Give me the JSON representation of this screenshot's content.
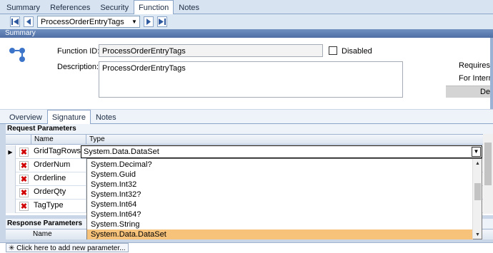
{
  "top_tabs": [
    "Summary",
    "References",
    "Security",
    "Function",
    "Notes"
  ],
  "active_top_tab": "Function",
  "nav": {
    "selected_function": "ProcessOrderEntryTags"
  },
  "summary": {
    "header": "Summary",
    "function_id_label": "Function ID:",
    "function_id_value": "ProcessOrderEntryTags",
    "disabled_label": "Disabled",
    "description_label": "Description:",
    "description_value": "ProcessOrderEntryTags",
    "requires_label": "Requires Tr",
    "internal_label": "For Internal",
    "right_button_label": "Des"
  },
  "inner_tabs": [
    "Overview",
    "Signature",
    "Notes"
  ],
  "active_inner_tab": "Signature",
  "request": {
    "header": "Request Parameters",
    "col_name": "Name",
    "col_type": "Type",
    "rows": [
      "GridTagRows",
      "OrderNum",
      "Orderline",
      "OrderQty",
      "TagType"
    ],
    "editor_value": "System.Data.DataSet"
  },
  "dropdown_options": [
    "System.Decimal?",
    "System.Guid",
    "System.Int32",
    "System.Int32?",
    "System.Int64",
    "System.Int64?",
    "System.String",
    "System.Data.DataSet"
  ],
  "dropdown_selected": "System.Data.DataSet",
  "response": {
    "header": "Response Parameters",
    "col_name": "Name"
  },
  "add_param_label": "Click here to add new parameter...",
  "colors": {
    "accent": "#4f6fa4",
    "highlight": "#f7c27a",
    "delete": "#d10000"
  }
}
